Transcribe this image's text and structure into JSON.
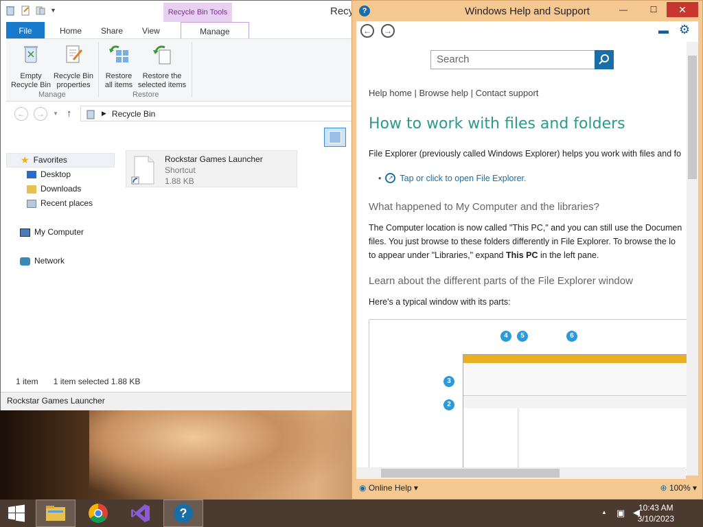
{
  "explorer": {
    "window_title": "Recyc",
    "context_tab": "Recycle Bin Tools",
    "tabs": [
      "File",
      "Home",
      "Share",
      "View",
      "Manage"
    ],
    "ribbon": {
      "empty_line1": "Empty",
      "empty_line2": "Recycle Bin",
      "props_line1": "Recycle Bin",
      "props_line2": "properties",
      "restore_all_line1": "Restore",
      "restore_all_line2": "all items",
      "restore_sel_line1": "Restore the",
      "restore_sel_line2": "selected items",
      "group_manage": "Manage",
      "group_restore": "Restore"
    },
    "address": "Recycle Bin",
    "nav": {
      "favorites": "Favorites",
      "desktop": "Desktop",
      "downloads": "Downloads",
      "recent": "Recent places",
      "my_computer": "My Computer",
      "network": "Network"
    },
    "file": {
      "name": "Rockstar Games Launcher",
      "type": "Shortcut",
      "size": "1.88 KB"
    },
    "status": {
      "count": "1 item",
      "selected": "1 item selected  1.88 KB"
    },
    "tooltip_bar": "Rockstar Games Launcher"
  },
  "help": {
    "window_title": "Windows Help and Support",
    "search_placeholder": "Search",
    "links": "Help home | Browse help | Contact support",
    "heading": "How to work with files and folders",
    "intro": "File Explorer (previously called Windows Explorer) helps you work with files and fo",
    "open_link": "Tap or click to open File Explorer.",
    "h2_computer": "What happened to My Computer and the libraries?",
    "p_line1": "The Computer location is now called \"This PC,\" and you can still use the Documen",
    "p_line2": "files. You just browse to these folders differently in File Explorer. To browse the lo",
    "p_line3_pre": "to appear under \"Libraries,\" expand ",
    "p_line3_bold": "This PC",
    "p_line3_post": " in the left pane.",
    "h2_parts": "Learn about the different parts of the File Explorer window",
    "p_typical": "Here's a typical window with its parts:",
    "callouts": [
      "4",
      "5",
      "6",
      "3",
      "2"
    ],
    "online_help": "Online Help",
    "zoom": "100%"
  },
  "taskbar": {
    "time": "10:43 AM",
    "date": "3/10/2023"
  }
}
